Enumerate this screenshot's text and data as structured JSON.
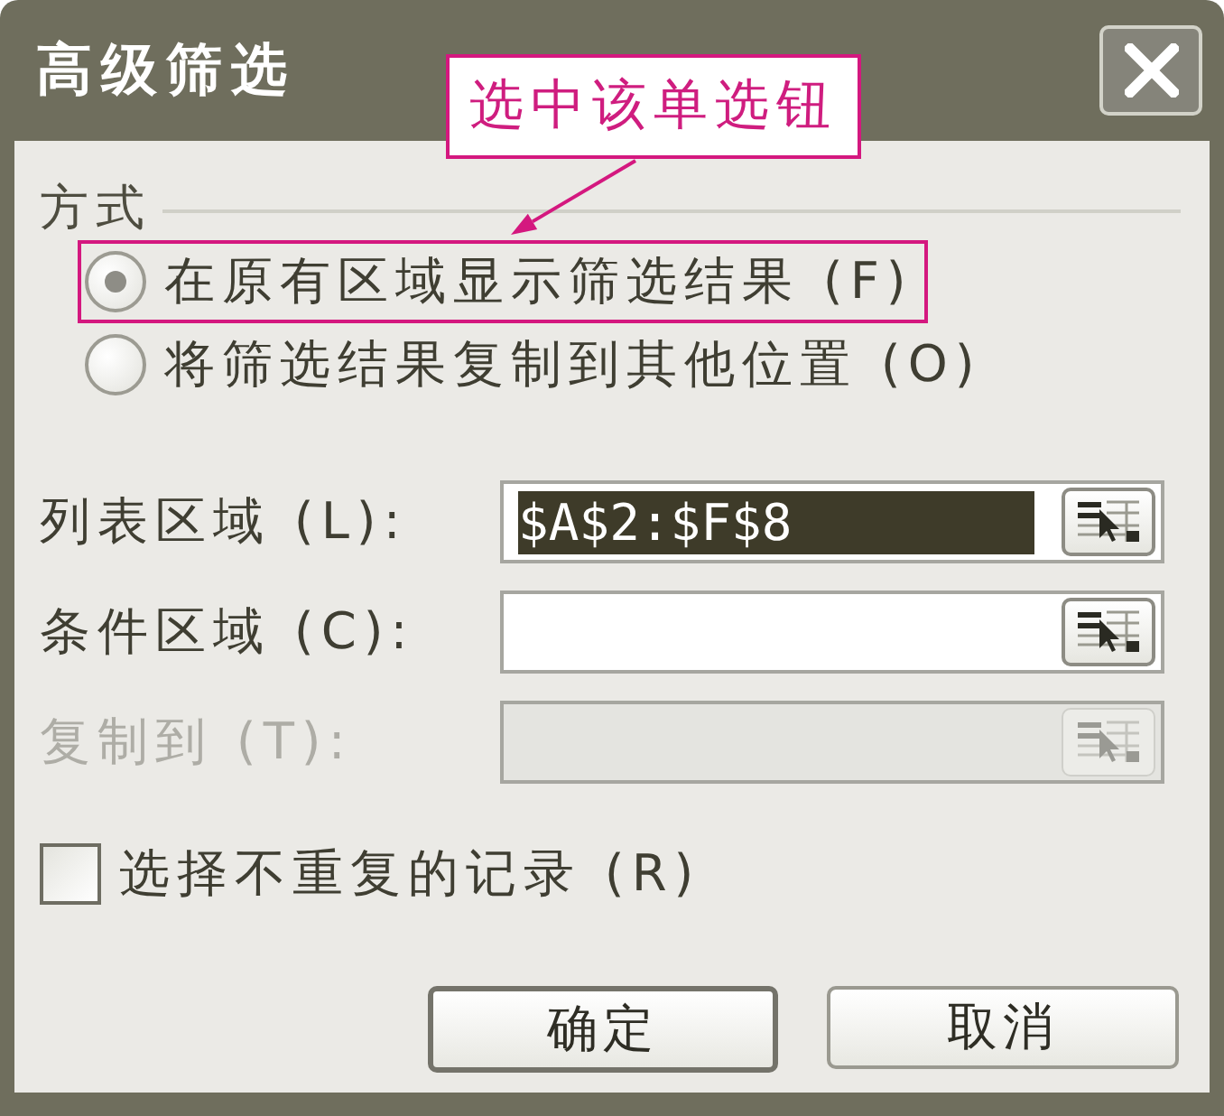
{
  "window": {
    "title": "高级筛选"
  },
  "callout": {
    "text": "选中该单选钮"
  },
  "mode": {
    "label": "方式",
    "options": [
      {
        "label": "在原有区域显示筛选结果 (F)",
        "selected": true,
        "annotated": true
      },
      {
        "label": "将筛选结果复制到其他位置 (O)",
        "selected": false,
        "annotated": false
      }
    ]
  },
  "fields": [
    {
      "label": "列表区域 (L):",
      "value": {
        "text": "$A$2:$F$8",
        "selected": true
      },
      "disabled": false
    },
    {
      "label": "条件区域 (C):",
      "disabled": false
    },
    {
      "label": "复制到 (T):",
      "disabled": true
    }
  ],
  "unique_records": {
    "label": "选择不重复的记录 (R)",
    "checked": false
  },
  "buttons": [
    {
      "label": "确定",
      "default": true
    },
    {
      "label": "取消",
      "default": false
    }
  ]
}
